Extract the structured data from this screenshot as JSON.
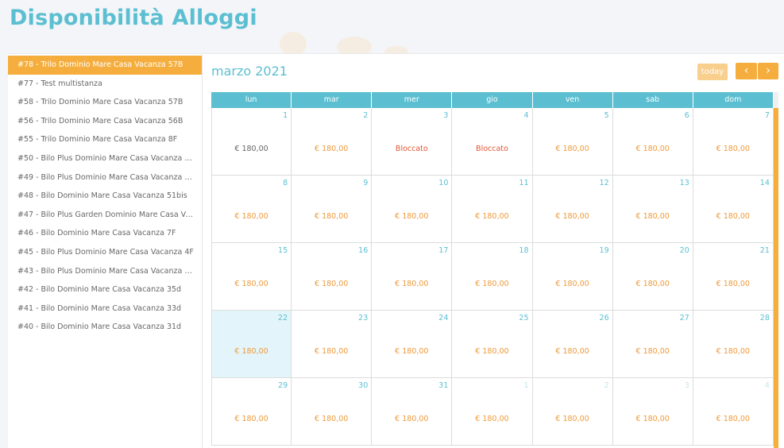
{
  "page": {
    "title": "Disponibilità Alloggi"
  },
  "sidebar": {
    "items": [
      {
        "label": "#78 - Trilo Dominio Mare Casa Vacanza 57B",
        "active": true
      },
      {
        "label": "#77 - Test multistanza"
      },
      {
        "label": "#58 - Trilo Dominio Mare Casa Vacanza 57B"
      },
      {
        "label": "#56 - Trilo Dominio Mare Casa Vacanza 56B"
      },
      {
        "label": "#55 - Trilo Dominio Mare Casa Vacanza 8F"
      },
      {
        "label": "#50 - Bilo Plus Dominio Mare Casa Vacanza 4..."
      },
      {
        "label": "#49 - Bilo Plus Dominio Mare Casa Vacanza 3..."
      },
      {
        "label": "#48 - Bilo Dominio Mare Casa Vacanza 51bis"
      },
      {
        "label": "#47 - Bilo Plus Garden Dominio Mare Casa Va..."
      },
      {
        "label": "#46 - Bilo Dominio Mare Casa Vacanza 7F"
      },
      {
        "label": "#45 - Bilo Plus Dominio Mare Casa Vacanza 4F"
      },
      {
        "label": "#43 - Bilo Plus Dominio Mare Casa Vacanza 3..."
      },
      {
        "label": "#42 - Bilo Dominio Mare Casa Vacanza 35d"
      },
      {
        "label": "#41 - Bilo Dominio Mare Casa Vacanza 33d"
      },
      {
        "label": "#40 - Bilo Dominio Mare Casa Vacanza 31d"
      }
    ]
  },
  "calendar": {
    "month_label": "marzo 2021",
    "today_label": "today",
    "prev_icon": "chevron-left-icon",
    "next_icon": "chevron-right-icon",
    "weekdays": [
      "lun",
      "mar",
      "mer",
      "gio",
      "ven",
      "sab",
      "dom"
    ],
    "weeks": [
      [
        {
          "day": "1",
          "price": "€ 180,00",
          "style": "grey"
        },
        {
          "day": "2",
          "price": "€ 180,00"
        },
        {
          "day": "3",
          "price": "Bloccato",
          "style": "blocked"
        },
        {
          "day": "4",
          "price": "Bloccato",
          "style": "blocked"
        },
        {
          "day": "5",
          "price": "€ 180,00"
        },
        {
          "day": "6",
          "price": "€ 180,00"
        },
        {
          "day": "7",
          "price": "€ 180,00"
        }
      ],
      [
        {
          "day": "8",
          "price": "€ 180,00"
        },
        {
          "day": "9",
          "price": "€ 180,00"
        },
        {
          "day": "10",
          "price": "€ 180,00"
        },
        {
          "day": "11",
          "price": "€ 180,00"
        },
        {
          "day": "12",
          "price": "€ 180,00"
        },
        {
          "day": "13",
          "price": "€ 180,00"
        },
        {
          "day": "14",
          "price": "€ 180,00"
        }
      ],
      [
        {
          "day": "15",
          "price": "€ 180,00"
        },
        {
          "day": "16",
          "price": "€ 180,00"
        },
        {
          "day": "17",
          "price": "€ 180,00"
        },
        {
          "day": "18",
          "price": "€ 180,00"
        },
        {
          "day": "19",
          "price": "€ 180,00"
        },
        {
          "day": "20",
          "price": "€ 180,00"
        },
        {
          "day": "21",
          "price": "€ 180,00"
        }
      ],
      [
        {
          "day": "22",
          "price": "€ 180,00",
          "today": true
        },
        {
          "day": "23",
          "price": "€ 180,00"
        },
        {
          "day": "24",
          "price": "€ 180,00"
        },
        {
          "day": "25",
          "price": "€ 180,00"
        },
        {
          "day": "26",
          "price": "€ 180,00"
        },
        {
          "day": "27",
          "price": "€ 180,00"
        },
        {
          "day": "28",
          "price": "€ 180,00"
        }
      ],
      [
        {
          "day": "29",
          "price": "€ 180,00"
        },
        {
          "day": "30",
          "price": "€ 180,00"
        },
        {
          "day": "31",
          "price": "€ 180,00"
        },
        {
          "day": "1",
          "price": "€ 180,00",
          "other": true
        },
        {
          "day": "2",
          "price": "€ 180,00",
          "other": true
        },
        {
          "day": "3",
          "price": "€ 180,00",
          "other": true
        },
        {
          "day": "4",
          "price": "€ 180,00",
          "other": true
        }
      ]
    ]
  },
  "colors": {
    "accent": "#5bbfd1",
    "orange": "#f5ae3e",
    "price": "#ee9a3a",
    "blocked": "#e35636"
  }
}
